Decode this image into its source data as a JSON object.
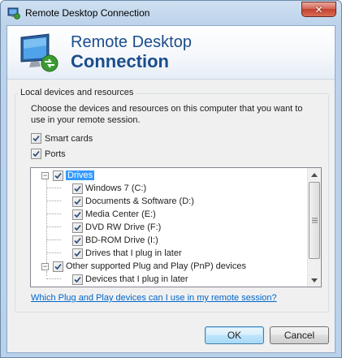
{
  "window": {
    "title": "Remote Desktop Connection",
    "close_glyph": "✕"
  },
  "header": {
    "line1": "Remote Desktop",
    "line2": "Connection"
  },
  "group": {
    "label": "Local devices and resources",
    "description": "Choose the devices and resources on this computer that you want to use in your remote session."
  },
  "options": [
    {
      "label": "Smart cards",
      "checked": true
    },
    {
      "label": "Ports",
      "checked": true
    }
  ],
  "tree": {
    "drives": {
      "label": "Drives",
      "checked": true,
      "expanded": true,
      "children": [
        {
          "label": "Windows 7 (C:)",
          "checked": true
        },
        {
          "label": "Documents & Software (D:)",
          "checked": true
        },
        {
          "label": "Media Center (E:)",
          "checked": true
        },
        {
          "label": "DVD RW Drive (F:)",
          "checked": true
        },
        {
          "label": "BD-ROM Drive (I:)",
          "checked": true
        },
        {
          "label": "Drives that I plug in later",
          "checked": true
        }
      ]
    },
    "pnp": {
      "label": "Other supported Plug and Play (PnP) devices",
      "checked": true,
      "expanded": true,
      "children": [
        {
          "label": "Devices that I plug in later",
          "checked": true
        }
      ]
    },
    "expander_glyph": "−"
  },
  "help_link": "Which Plug and Play devices can I use in my remote session?",
  "buttons": {
    "ok": "OK",
    "cancel": "Cancel"
  },
  "colors": {
    "accent": "#1b4d8c",
    "link": "#0066cc",
    "selection": "#3399ff"
  }
}
